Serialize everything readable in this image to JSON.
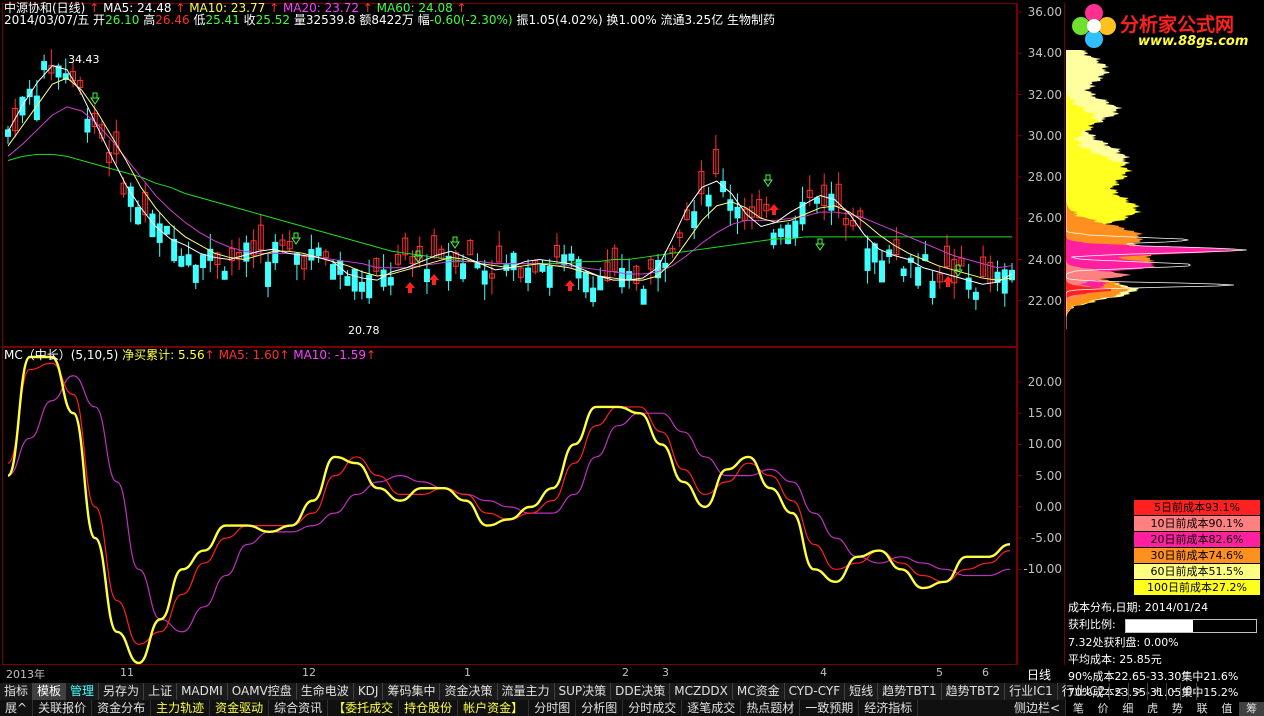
{
  "main": {
    "title": "中源协和(日线)",
    "ma_labels": [
      {
        "text": "MA5: 24.48",
        "color": "#ffffff"
      },
      {
        "text": "MA10: 23.77",
        "color": "#ffff40"
      },
      {
        "text": "MA20: 23.72",
        "color": "#ff40ff"
      },
      {
        "text": "MA60: 24.08",
        "color": "#40ff40"
      }
    ],
    "quote_line": {
      "date": "2014/03/07/五",
      "open_label": "开",
      "open": "26.10",
      "high_label": "高",
      "high": "26.46",
      "low_label": "低",
      "low": "25.41",
      "close_label": "收",
      "close": "25.52",
      "vol_label": "量",
      "vol": "32539.8",
      "amt_label": "额",
      "amt": "8422万",
      "chg_label": "幅",
      "chg": "-0.60(-2.30%)",
      "amp_label": "振",
      "amp": "1.05(4.02%)",
      "turn_label": "换",
      "turn": "1.00%",
      "float_label": "流通",
      "float": "3.25亿",
      "sector": "生物制药"
    },
    "price_high_label": "34.43",
    "price_low_label": "20.78",
    "y_ticks": [
      "36.00",
      "34.00",
      "32.00",
      "30.00",
      "28.00",
      "26.00",
      "24.00",
      "22.00"
    ]
  },
  "indicator": {
    "name": "MC（中长）(5,10,5)",
    "net_label": "净买累计: 5.56",
    "ma5_label": "MA5: 1.60",
    "ma10_label": "MA10: -1.59",
    "y_ticks": [
      "20.00",
      "15.00",
      "10.00",
      "5.00",
      "0.00",
      "-5.00",
      "-10.00"
    ]
  },
  "x_axis": {
    "labels": [
      "2013年",
      "11",
      "12",
      "1",
      "2",
      "3",
      "4",
      "5",
      "6"
    ],
    "period": "日线"
  },
  "chart_data": {
    "type": "line",
    "title": "中源协和(日线)",
    "candles_ylim": [
      20,
      36
    ],
    "ma5": [
      30.2,
      31.5,
      32.6,
      33.4,
      33.2,
      32.0,
      30.5,
      29.0,
      27.6,
      26.5,
      25.6,
      25.0,
      24.7,
      24.3,
      24.1,
      24.0,
      24.2,
      24.4,
      24.5,
      24.3,
      24.2,
      24.1,
      23.9,
      23.3,
      23.1,
      23.0,
      23.4,
      23.6,
      23.9,
      24.2,
      24.4,
      24.1,
      23.8,
      23.5,
      23.6,
      23.9,
      24.0,
      23.9,
      23.8,
      23.5,
      23.2,
      23.0,
      23.0,
      23.1,
      23.6,
      25.0,
      26.5,
      27.5,
      27.8,
      27.2,
      26.2,
      25.6,
      25.8,
      26.3,
      26.7,
      27.1,
      26.9,
      26.2,
      25.2,
      24.5,
      24.2,
      24.0,
      23.6,
      23.4,
      23.2,
      23.0,
      22.8,
      22.9,
      23.3
    ],
    "ma10": [
      29.5,
      30.5,
      31.5,
      32.5,
      32.8,
      32.2,
      31.2,
      30.0,
      28.8,
      27.5,
      26.5,
      25.7,
      25.1,
      24.7,
      24.3,
      24.1,
      24.0,
      24.2,
      24.4,
      24.4,
      24.3,
      24.1,
      23.9,
      23.7,
      23.4,
      23.2,
      23.3,
      23.5,
      23.7,
      23.9,
      24.1,
      24.0,
      23.8,
      23.7,
      23.6,
      23.7,
      23.8,
      23.7,
      23.6,
      23.4,
      23.2,
      23.1,
      23.0,
      23.0,
      23.2,
      23.9,
      24.9,
      25.9,
      26.6,
      26.8,
      26.5,
      26.0,
      25.8,
      25.9,
      26.2,
      26.5,
      26.6,
      26.3,
      25.8,
      25.2,
      24.7,
      24.3,
      24.0,
      23.7,
      23.5,
      23.3,
      23.1,
      23.0,
      23.1
    ],
    "ma20": [
      29.0,
      29.6,
      30.3,
      31.0,
      31.4,
      31.2,
      30.6,
      29.8,
      28.9,
      28.0,
      27.1,
      26.4,
      25.8,
      25.3,
      24.9,
      24.6,
      24.4,
      24.3,
      24.3,
      24.3,
      24.2,
      24.1,
      24.0,
      23.9,
      23.8,
      23.6,
      23.6,
      23.6,
      23.7,
      23.8,
      23.9,
      23.9,
      23.9,
      23.8,
      23.8,
      23.8,
      23.8,
      23.7,
      23.7,
      23.6,
      23.5,
      23.4,
      23.3,
      23.3,
      23.4,
      23.7,
      24.2,
      24.8,
      25.3,
      25.7,
      25.9,
      25.9,
      25.9,
      26.0,
      26.1,
      26.3,
      26.3,
      26.2,
      26.0,
      25.7,
      25.4,
      25.1,
      24.8,
      24.5,
      24.2,
      24.0,
      23.8,
      23.6,
      23.7
    ],
    "ma60": [
      28.8,
      29.0,
      29.1,
      29.1,
      29.0,
      28.8,
      28.6,
      28.4,
      28.2,
      28.0,
      27.7,
      27.5,
      27.2,
      27.0,
      26.8,
      26.6,
      26.4,
      26.2,
      26.0,
      25.8,
      25.6,
      25.4,
      25.2,
      25.0,
      24.8,
      24.6,
      24.4,
      24.3,
      24.2,
      24.1,
      24.0,
      23.9,
      23.9,
      23.8,
      23.8,
      23.8,
      23.8,
      23.8,
      23.8,
      23.9,
      23.9,
      24.0,
      24.0,
      24.1,
      24.2,
      24.3,
      24.4,
      24.5,
      24.6,
      24.7,
      24.8,
      24.9,
      25.0,
      25.0,
      25.1,
      25.1,
      25.1,
      25.1,
      25.1,
      25.1,
      25.1,
      25.1,
      25.1,
      25.1,
      25.1,
      25.1,
      25.1,
      25.1,
      25.1
    ],
    "indicator_ylim": [
      -25,
      24
    ],
    "mc": [
      5,
      24,
      24,
      15,
      -5,
      -20,
      -25,
      -18,
      -10,
      -7,
      -3,
      -3,
      -4,
      -3,
      1,
      8,
      7,
      3,
      1,
      3,
      3,
      1,
      -3,
      -2,
      0,
      3,
      10,
      16,
      16,
      15,
      10,
      4,
      0,
      6,
      8,
      3,
      -1,
      -10,
      -12,
      -8,
      -7,
      -10,
      -13,
      -12,
      -8,
      -8,
      -6
    ],
    "mc_ma5": [
      7,
      22,
      23,
      18,
      0,
      -15,
      -22,
      -20,
      -14,
      -9,
      -5,
      -3,
      -3,
      -3,
      -1,
      5,
      8,
      5,
      2,
      2,
      3,
      2,
      -1,
      -2,
      -1,
      1,
      7,
      13,
      16,
      16,
      12,
      6,
      2,
      4,
      7,
      5,
      1,
      -6,
      -10,
      -9,
      -7,
      -9,
      -11,
      -12,
      -10,
      -9,
      -7
    ],
    "mc_ma10": [
      5,
      11,
      17,
      21,
      16,
      4,
      -10,
      -18,
      -20,
      -16,
      -11,
      -6,
      -4,
      -4,
      -3,
      -1,
      2,
      4,
      5,
      4,
      3,
      2,
      1,
      0,
      -1,
      -1,
      2,
      8,
      13,
      15,
      15,
      12,
      8,
      5,
      5,
      6,
      4,
      -1,
      -5,
      -8,
      -9,
      -8,
      -9,
      -10,
      -11,
      -11,
      -10
    ]
  },
  "right_panel": {
    "logo_text": "分析家公式网",
    "logo_url": "www.88gs.com",
    "legend": [
      {
        "text": "5日前成本93.1%",
        "color": "#ff2020"
      },
      {
        "text": "10日前成本90.1%",
        "color": "#ff8080"
      },
      {
        "text": "20日前成本82.6%",
        "color": "#ff20a0"
      },
      {
        "text": "30日前成本74.6%",
        "color": "#ff9020"
      },
      {
        "text": "60日前成本51.5%",
        "color": "#ffff80"
      },
      {
        "text": "100日前成本27.2%",
        "color": "#ffff20"
      }
    ],
    "dist_label": "成本分布,日期:",
    "dist_date": "2014/01/24",
    "profit_label": "获利比例:",
    "profit_value": "51.7%",
    "profit_ratio": 0.517,
    "line1": "7.32处获利盘: 0.00%",
    "line2": "平均成本: 25.85元",
    "line3": "90%成本22.65-33.30集中21.6%",
    "line4": "70%成本23.55-31.05集中15.2%",
    "bottom_tabs": [
      "笔",
      "价",
      "细",
      "虎",
      "势",
      "联",
      "值",
      "筹"
    ]
  },
  "tabs_row1": [
    "指标",
    "模板",
    "管理",
    "另存为",
    "上证",
    "MADMI",
    "OAMV控盘",
    "生命电波",
    "KDJ",
    "筹码集中",
    "资金决策",
    "流量主力",
    "SUP决策",
    "DDE决策",
    "MCZDDX",
    "MC资金",
    "CYD-CYF",
    "短线",
    "趋势TBT1",
    "趋势TBT2",
    "行业IC1",
    "行业IC2"
  ],
  "tabs_row1_nav": [
    "<",
    ">"
  ],
  "tabs_row1_zoom": [
    "+",
    "-",
    "0"
  ],
  "tabs_row2": [
    "展^",
    "关联报价",
    "资金分布",
    "主力轨迹",
    "资金驱动",
    "综合资讯",
    "【委托成交",
    "持仓股份",
    "帐户资金】",
    "分时图",
    "分析图",
    "分时成交",
    "逐笔成交",
    "热点题材",
    "一致预期",
    "经济指标"
  ],
  "tabs_row2_right": "侧边栏<",
  "colors": {
    "up": "#ff3030",
    "down": "#40ffff",
    "frame": "#800000",
    "mc": "#ffff40",
    "mc_ma5": "#ff2020",
    "mc_ma10": "#c030c0"
  }
}
